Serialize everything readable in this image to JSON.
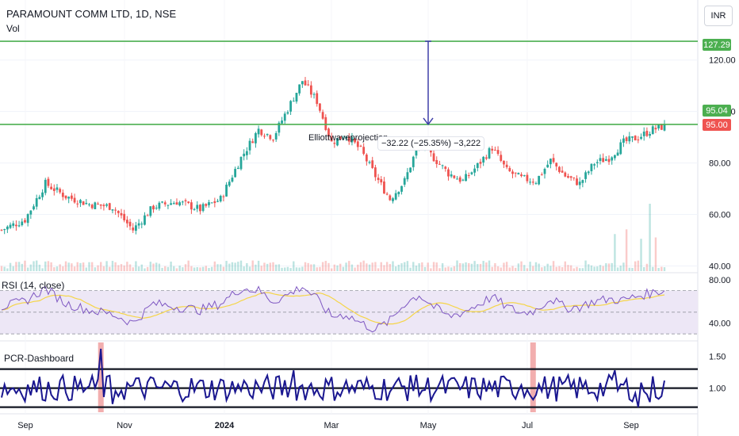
{
  "header": {
    "title": "PARAMOUNT COMM LTD, 1D, NSE",
    "volume_label": "Vol",
    "currency_button": "INR"
  },
  "colors": {
    "up": "#26a69a",
    "down": "#ef5350",
    "level_line": "#4caf50",
    "rsi_line": "#7e57c2",
    "rsi_ma": "#f5d547",
    "rsi_band": "#ede7f6",
    "pcr_line": "#1a1790",
    "pcr_highlight": "#ef9a9a",
    "arrow": "#3f3fa8"
  },
  "annotations": {
    "projection_label": "Elliottwaveprojection",
    "measure_label": "−32.22 (−25.35%) −3,222"
  },
  "price_badges": {
    "target": "127.29",
    "last_high": "95.04",
    "level": "95.00"
  },
  "chart_data": [
    {
      "type": "candlestick",
      "title": "PARAMOUNT COMM LTD, 1D, NSE",
      "ylim": [
        38,
        131
      ],
      "y_ticks": [
        {
          "value": 120,
          "label": "120.00"
        },
        {
          "value": 100,
          "label": "100.00"
        },
        {
          "value": 80,
          "label": "80.00"
        },
        {
          "value": 60,
          "label": "60.00"
        },
        {
          "value": 40,
          "label": "40.00"
        }
      ],
      "x_ticks": [
        "Sep",
        "Nov",
        "2024",
        "Mar",
        "May",
        "Jul",
        "Sep"
      ],
      "horizontal_levels": [
        127.29,
        95.0
      ],
      "close_path": [
        {
          "t": 0,
          "v": 54
        },
        {
          "t": 8,
          "v": 58
        },
        {
          "t": 15,
          "v": 72
        },
        {
          "t": 22,
          "v": 67
        },
        {
          "t": 30,
          "v": 64
        },
        {
          "t": 38,
          "v": 63
        },
        {
          "t": 45,
          "v": 54
        },
        {
          "t": 52,
          "v": 63
        },
        {
          "t": 60,
          "v": 65
        },
        {
          "t": 68,
          "v": 62
        },
        {
          "t": 75,
          "v": 66
        },
        {
          "t": 82,
          "v": 82
        },
        {
          "t": 88,
          "v": 93
        },
        {
          "t": 93,
          "v": 90
        },
        {
          "t": 98,
          "v": 101
        },
        {
          "t": 103,
          "v": 112
        },
        {
          "t": 108,
          "v": 104
        },
        {
          "t": 113,
          "v": 88
        },
        {
          "t": 118,
          "v": 91
        },
        {
          "t": 123,
          "v": 85
        },
        {
          "t": 128,
          "v": 75
        },
        {
          "t": 133,
          "v": 66
        },
        {
          "t": 138,
          "v": 73
        },
        {
          "t": 143,
          "v": 88
        },
        {
          "t": 148,
          "v": 82
        },
        {
          "t": 153,
          "v": 76
        },
        {
          "t": 158,
          "v": 73
        },
        {
          "t": 163,
          "v": 79
        },
        {
          "t": 168,
          "v": 86
        },
        {
          "t": 173,
          "v": 77
        },
        {
          "t": 178,
          "v": 74
        },
        {
          "t": 183,
          "v": 73
        },
        {
          "t": 188,
          "v": 81
        },
        {
          "t": 193,
          "v": 75
        },
        {
          "t": 198,
          "v": 72
        },
        {
          "t": 203,
          "v": 80
        },
        {
          "t": 208,
          "v": 82
        },
        {
          "t": 213,
          "v": 88
        },
        {
          "t": 218,
          "v": 90
        },
        {
          "t": 223,
          "v": 93
        },
        {
          "t": 226,
          "v": 94
        }
      ],
      "total_bars": 228,
      "volume_spikes": [
        {
          "t": 210,
          "v": 0.55
        },
        {
          "t": 214,
          "v": 0.62
        },
        {
          "t": 219,
          "v": 0.48
        },
        {
          "t": 222,
          "v": 1.0
        },
        {
          "t": 224,
          "v": 0.5
        }
      ]
    },
    {
      "type": "line",
      "title": "RSI (14, close)",
      "ylim": [
        25,
        85
      ],
      "y_ticks": [
        {
          "value": 80,
          "label": "80.00"
        },
        {
          "value": 40,
          "label": "40.00"
        }
      ],
      "band": [
        30,
        70
      ],
      "mid": 50,
      "rsi_path": [
        {
          "t": 0,
          "v": 55
        },
        {
          "t": 8,
          "v": 60
        },
        {
          "t": 15,
          "v": 72
        },
        {
          "t": 22,
          "v": 58
        },
        {
          "t": 30,
          "v": 52
        },
        {
          "t": 38,
          "v": 48
        },
        {
          "t": 45,
          "v": 40
        },
        {
          "t": 52,
          "v": 58
        },
        {
          "t": 60,
          "v": 55
        },
        {
          "t": 68,
          "v": 52
        },
        {
          "t": 75,
          "v": 58
        },
        {
          "t": 82,
          "v": 72
        },
        {
          "t": 88,
          "v": 70
        },
        {
          "t": 93,
          "v": 60
        },
        {
          "t": 98,
          "v": 66
        },
        {
          "t": 103,
          "v": 74
        },
        {
          "t": 108,
          "v": 62
        },
        {
          "t": 113,
          "v": 46
        },
        {
          "t": 118,
          "v": 48
        },
        {
          "t": 123,
          "v": 40
        },
        {
          "t": 128,
          "v": 34
        },
        {
          "t": 133,
          "v": 42
        },
        {
          "t": 138,
          "v": 58
        },
        {
          "t": 143,
          "v": 66
        },
        {
          "t": 148,
          "v": 55
        },
        {
          "t": 153,
          "v": 46
        },
        {
          "t": 158,
          "v": 50
        },
        {
          "t": 163,
          "v": 57
        },
        {
          "t": 168,
          "v": 64
        },
        {
          "t": 173,
          "v": 55
        },
        {
          "t": 178,
          "v": 49
        },
        {
          "t": 183,
          "v": 52
        },
        {
          "t": 188,
          "v": 63
        },
        {
          "t": 193,
          "v": 54
        },
        {
          "t": 198,
          "v": 55
        },
        {
          "t": 203,
          "v": 60
        },
        {
          "t": 208,
          "v": 62
        },
        {
          "t": 213,
          "v": 61
        },
        {
          "t": 218,
          "v": 65
        },
        {
          "t": 223,
          "v": 68
        },
        {
          "t": 226,
          "v": 70
        }
      ]
    },
    {
      "type": "line",
      "title": "PCR-Dashboard",
      "ylim": [
        0.62,
        1.72
      ],
      "y_ticks": [
        {
          "value": 1.5,
          "label": "1.50"
        },
        {
          "value": 1.0,
          "label": "1.00"
        }
      ],
      "levels": [
        1.3,
        1.0,
        0.7
      ],
      "spikes": [
        {
          "t": 34,
          "v": 1.62
        },
        {
          "t": 38,
          "v": 0.75
        },
        {
          "t": 84,
          "v": 1.05
        },
        {
          "t": 100,
          "v": 1.28
        },
        {
          "t": 140,
          "v": 1.2
        },
        {
          "t": 178,
          "v": 1.05
        },
        {
          "t": 210,
          "v": 1.28
        },
        {
          "t": 218,
          "v": 0.7
        },
        {
          "t": 222,
          "v": 0.78
        }
      ],
      "highlight_bars": [
        34,
        182
      ]
    }
  ]
}
